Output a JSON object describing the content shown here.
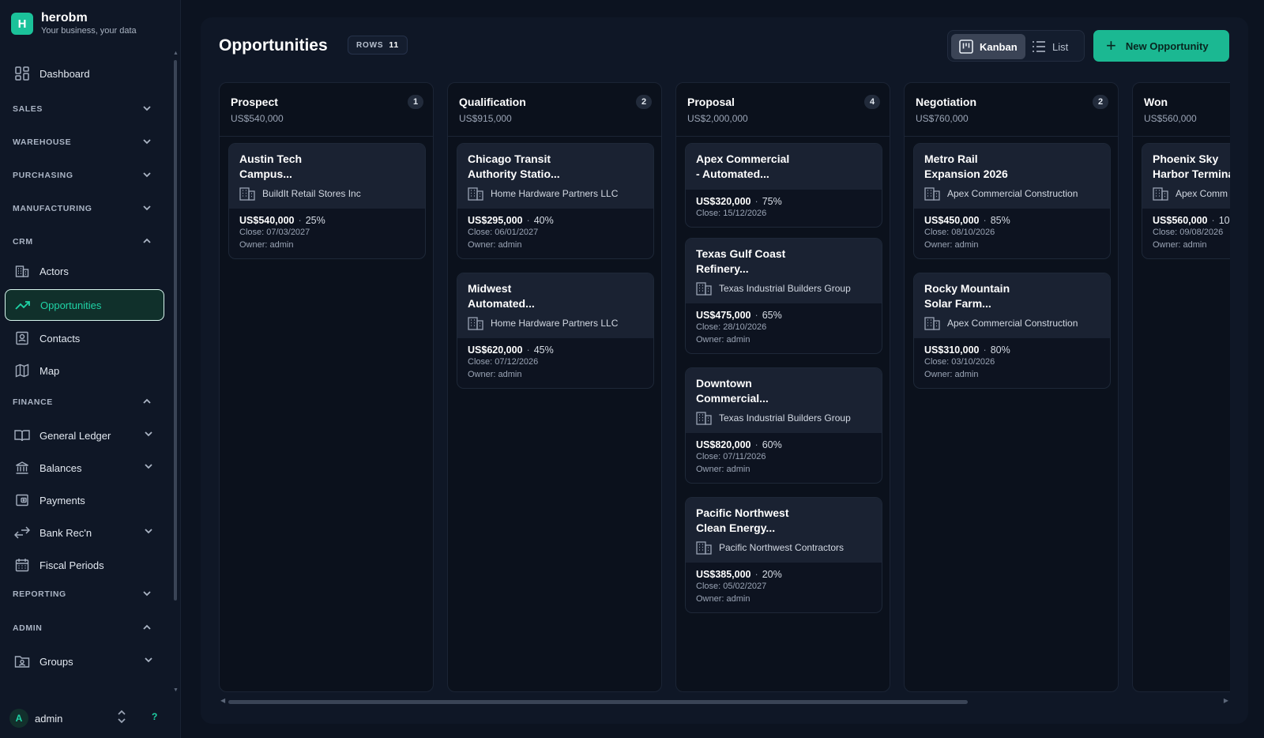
{
  "brand": {
    "logo_letter": "H",
    "name": "herobm",
    "tagline": "Your business, your data"
  },
  "sidebar": {
    "dashboard": "Dashboard",
    "sections": {
      "sales": "SALES",
      "warehouse": "WAREHOUSE",
      "purchasing": "PURCHASING",
      "manufacturing": "MANUFACTURING",
      "crm": "CRM",
      "finance": "FINANCE",
      "reporting": "REPORTING",
      "admin": "ADMIN"
    },
    "crm_items": [
      "Actors",
      "Opportunities",
      "Contacts",
      "Map"
    ],
    "finance_items": [
      "General Ledger",
      "Balances",
      "Payments",
      "Bank Rec'n",
      "Fiscal Periods"
    ],
    "admin_items": [
      "Groups"
    ],
    "active_item": "Opportunities"
  },
  "user": {
    "initial": "A",
    "name": "admin",
    "help": "?"
  },
  "header": {
    "title": "Opportunities",
    "rows_label": "ROWS",
    "rows_count": "11",
    "view_kanban": "Kanban",
    "view_list": "List",
    "active_view": "Kanban",
    "new_button": "New Opportunity"
  },
  "columns": [
    {
      "title": "Prospect",
      "total": "US$540,000",
      "count": "1",
      "cards": [
        {
          "title_line1": "Austin Tech",
          "title_line2": "Campus...",
          "company": "BuildIt Retail Stores Inc",
          "amount": "US$540,000",
          "pct": "25%",
          "close": "Close: 07/03/2027",
          "owner": "Owner: admin"
        }
      ]
    },
    {
      "title": "Qualification",
      "total": "US$915,000",
      "count": "2",
      "cards": [
        {
          "title_line1": "Chicago Transit",
          "title_line2": "Authority Statio...",
          "company": "Home Hardware Partners LLC",
          "amount": "US$295,000",
          "pct": "40%",
          "close": "Close: 06/01/2027",
          "owner": "Owner: admin"
        },
        {
          "title_line1": "Midwest",
          "title_line2": "Automated...",
          "company": "Home Hardware Partners LLC",
          "amount": "US$620,000",
          "pct": "45%",
          "close": "Close: 07/12/2026",
          "owner": "Owner: admin"
        }
      ]
    },
    {
      "title": "Proposal",
      "total": "US$2,000,000",
      "count": "4",
      "cards": [
        {
          "title_line1": "Apex Commercial",
          "title_line2": "- Automated...",
          "company": "",
          "amount": "US$320,000",
          "pct": "75%",
          "close": "Close: 15/12/2026",
          "owner": ""
        },
        {
          "title_line1": "Texas Gulf Coast",
          "title_line2": "Refinery...",
          "company": "Texas Industrial Builders Group",
          "amount": "US$475,000",
          "pct": "65%",
          "close": "Close: 28/10/2026",
          "owner": "Owner: admin"
        },
        {
          "title_line1": "Downtown",
          "title_line2": "Commercial...",
          "company": "Texas Industrial Builders Group",
          "amount": "US$820,000",
          "pct": "60%",
          "close": "Close: 07/11/2026",
          "owner": "Owner: admin"
        },
        {
          "title_line1": "Pacific Northwest",
          "title_line2": "Clean Energy...",
          "company": "Pacific Northwest Contractors",
          "amount": "US$385,000",
          "pct": "20%",
          "close": "Close: 05/02/2027",
          "owner": "Owner: admin"
        }
      ]
    },
    {
      "title": "Negotiation",
      "total": "US$760,000",
      "count": "2",
      "cards": [
        {
          "title_line1": "Metro Rail",
          "title_line2": "Expansion 2026",
          "company": "Apex Commercial Construction",
          "amount": "US$450,000",
          "pct": "85%",
          "close": "Close: 08/10/2026",
          "owner": "Owner: admin"
        },
        {
          "title_line1": "Rocky Mountain",
          "title_line2": "Solar Farm...",
          "company": "Apex Commercial Construction",
          "amount": "US$310,000",
          "pct": "80%",
          "close": "Close: 03/10/2026",
          "owner": "Owner: admin"
        }
      ]
    },
    {
      "title": "Won",
      "total": "US$560,000",
      "count": "",
      "cards": [
        {
          "title_line1": "Phoenix Sky",
          "title_line2": "Harbor Termina",
          "company": "Apex Comm",
          "amount": "US$560,000",
          "pct": "10",
          "close": "Close: 09/08/2026",
          "owner": "Owner: admin"
        }
      ]
    }
  ],
  "colors": {
    "accent": "#1bb892",
    "background": "#0c1320",
    "panel": "#0f1726",
    "card_header": "#1a2232"
  }
}
